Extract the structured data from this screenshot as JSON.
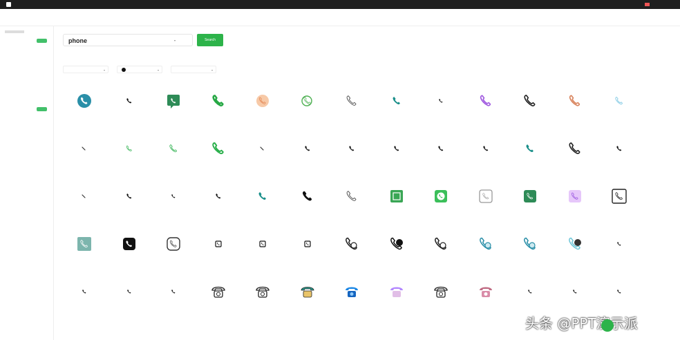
{
  "search": {
    "value": "phone",
    "button": "Search"
  },
  "colors": {
    "accent": "#2db34a"
  },
  "icons": [
    {
      "style": "teal-circle"
    },
    {
      "style": "black-small"
    },
    {
      "style": "green-square"
    },
    {
      "style": "green-bold"
    },
    {
      "style": "peach-circle"
    },
    {
      "style": "green-outline-swirl"
    },
    {
      "style": "outline-grey"
    },
    {
      "style": "teal"
    },
    {
      "style": "black-tiny"
    },
    {
      "style": "purple-gradient"
    },
    {
      "style": "black-outline"
    },
    {
      "style": "peach-outline"
    },
    {
      "style": "light-blue"
    },
    {
      "style": "line"
    },
    {
      "style": "green-small"
    },
    {
      "style": "green-outline"
    },
    {
      "style": "green-big"
    },
    {
      "style": "line"
    },
    {
      "style": "black-small"
    },
    {
      "style": "black-small"
    },
    {
      "style": "black-small"
    },
    {
      "style": "black-small"
    },
    {
      "style": "black-small"
    },
    {
      "style": "teal"
    },
    {
      "style": "black-outline"
    },
    {
      "style": "black-small"
    },
    {
      "style": "line"
    },
    {
      "style": "black-small"
    },
    {
      "style": "black-tiny"
    },
    {
      "style": "black-small"
    },
    {
      "style": "teal"
    },
    {
      "style": "black-bold"
    },
    {
      "style": "outline-grey"
    },
    {
      "style": "green-grid"
    },
    {
      "style": "green-whatsapp"
    },
    {
      "style": "grey-square"
    },
    {
      "style": "green-rounded"
    },
    {
      "style": "purple-square"
    },
    {
      "style": "outline-square"
    },
    {
      "style": "teal-square"
    },
    {
      "style": "black-rounded"
    },
    {
      "style": "outline-rounded"
    },
    {
      "style": "black-tiny-square"
    },
    {
      "style": "black-tiny-square"
    },
    {
      "style": "black-tiny-square"
    },
    {
      "style": "contact-outline"
    },
    {
      "style": "chat-black"
    },
    {
      "style": "contact-outline"
    },
    {
      "style": "contact-teal"
    },
    {
      "style": "contact-teal"
    },
    {
      "style": "chat-teal"
    },
    {
      "style": "black-tiny"
    },
    {
      "style": "black-tiny"
    },
    {
      "style": "black-tiny"
    },
    {
      "style": "black-tiny"
    },
    {
      "style": "retro-outline"
    },
    {
      "style": "retro-outline"
    },
    {
      "style": "retro-teal"
    },
    {
      "style": "retro-blue"
    },
    {
      "style": "retro-purple"
    },
    {
      "style": "retro-outline"
    },
    {
      "style": "retro-pink"
    },
    {
      "style": "black-tiny"
    },
    {
      "style": "black-tiny"
    },
    {
      "style": "black-tiny"
    }
  ]
}
